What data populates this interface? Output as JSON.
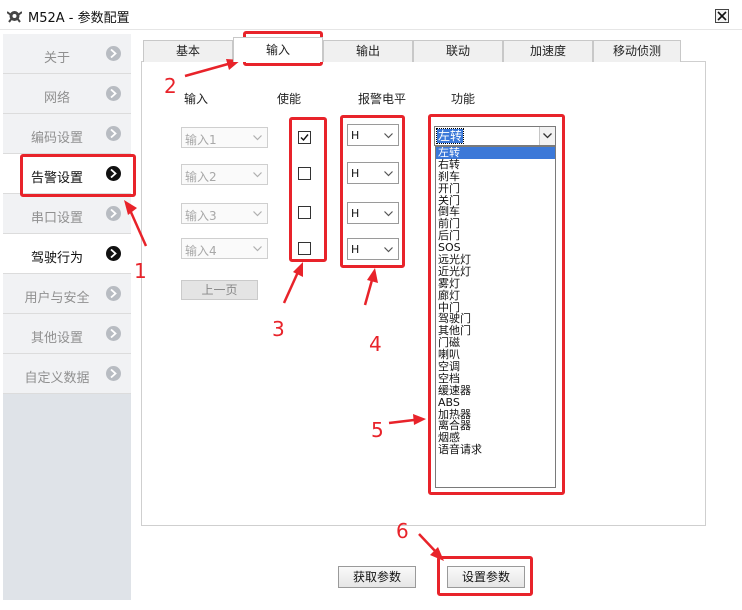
{
  "window": {
    "title": "M52A - 参数配置"
  },
  "sidebar": {
    "items": [
      {
        "label": "关于",
        "active": false
      },
      {
        "label": "网络",
        "active": false
      },
      {
        "label": "编码设置",
        "active": false
      },
      {
        "label": "告警设置",
        "active": true
      },
      {
        "label": "串口设置",
        "active": false
      },
      {
        "label": "驾驶行为",
        "active": true
      },
      {
        "label": "用户与安全",
        "active": false
      },
      {
        "label": "其他设置",
        "active": false
      },
      {
        "label": "自定义数据",
        "active": false
      }
    ]
  },
  "tabs": [
    {
      "label": "基本",
      "active": false
    },
    {
      "label": "输入",
      "active": true
    },
    {
      "label": "输出",
      "active": false
    },
    {
      "label": "联动",
      "active": false
    },
    {
      "label": "加速度",
      "active": false
    },
    {
      "label": "移动侦测",
      "active": false
    }
  ],
  "columns": {
    "input": "输入",
    "enable": "使能",
    "alarm_level": "报警电平",
    "function": "功能"
  },
  "rows": [
    {
      "input": "输入1",
      "enabled": true,
      "level": "H"
    },
    {
      "input": "输入2",
      "enabled": false,
      "level": "H"
    },
    {
      "input": "输入3",
      "enabled": false,
      "level": "H"
    },
    {
      "input": "输入4",
      "enabled": false,
      "level": "H"
    }
  ],
  "prev_page_label": "上一页",
  "function_select": {
    "value": "左转",
    "options": [
      "左转",
      "右转",
      "刹车",
      "开门",
      "关门",
      "倒车",
      "前门",
      "后门",
      "SOS",
      "远光灯",
      "近光灯",
      "雾灯",
      "廊灯",
      "中门",
      "驾驶门",
      "其他门",
      "门磁",
      "喇叭",
      "空调",
      "空档",
      "缓速器",
      "ABS",
      "加热器",
      "离合器",
      "烟感",
      "语音请求"
    ]
  },
  "buttons": {
    "get_params": "获取参数",
    "set_params": "设置参数"
  },
  "annotations": [
    "1",
    "2",
    "3",
    "4",
    "5",
    "6"
  ],
  "colors": {
    "annotation": "#e8232a",
    "selection": "#3b78d8"
  }
}
